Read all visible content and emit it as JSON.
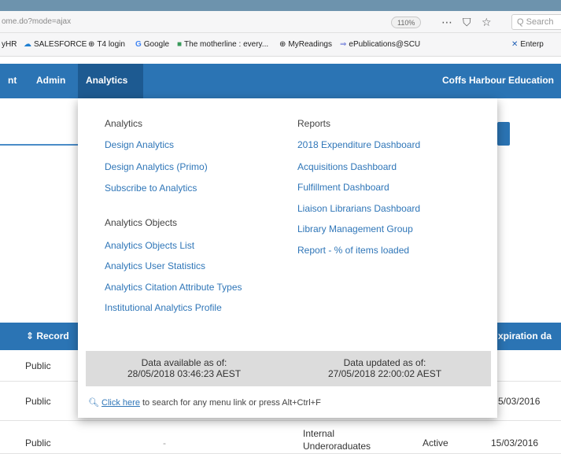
{
  "browser": {
    "url": "ome.do?mode=ajax",
    "zoom": "110%",
    "search_placeholder": "Q Search",
    "bookmarks": [
      {
        "label": "yHR",
        "icon": "text"
      },
      {
        "label": "SALESFORCE",
        "icon": "cloud-icon"
      },
      {
        "label": "T4 login",
        "icon": "globe-icon"
      },
      {
        "label": "Google",
        "icon": "google-icon"
      },
      {
        "label": "The motherline : every...",
        "icon": "bookmark-icon"
      },
      {
        "label": "MyReadings",
        "icon": "globe-icon"
      },
      {
        "label": "ePublications@SCU",
        "icon": "link-icon"
      },
      {
        "label": "Enterp",
        "icon": "x-icon"
      }
    ]
  },
  "nav": {
    "items": [
      "nt",
      "Admin",
      "Analytics"
    ],
    "institution": "Coffs Harbour Education"
  },
  "dropdown": {
    "analytics": {
      "heading": "Analytics",
      "links": [
        "Design Analytics",
        "Design Analytics (Primo)",
        "Subscribe to Analytics"
      ]
    },
    "objects": {
      "heading": "Analytics Objects",
      "links": [
        "Analytics Objects List",
        "Analytics User Statistics",
        "Analytics Citation Attribute Types",
        "Institutional Analytics Profile"
      ]
    },
    "reports": {
      "heading": "Reports",
      "links": [
        "2018 Expenditure Dashboard",
        "Acquisitions Dashboard",
        "Fulfillment Dashboard",
        "Liaison Librarians Dashboard",
        "Library Management Group",
        "Report - % of items loaded"
      ]
    },
    "data_available_label": "Data available as of:",
    "data_available_value": "28/05/2018 03:46:23 AEST",
    "data_updated_label": "Data updated as of:",
    "data_updated_value": "27/05/2018 22:00:02 AEST",
    "hint_link": "Click here",
    "hint_text": " to search for any menu link or press Alt+Ctrl+F"
  },
  "table": {
    "headers": {
      "record": "Record",
      "expiration": "xpiration da"
    },
    "rows": [
      {
        "record": "Public",
        "expiration": ""
      },
      {
        "record": "Public",
        "expiration": "5/03/2016"
      },
      {
        "record": "Public",
        "mid": "-",
        "group": "Internal Underoraduates",
        "status": "Active",
        "expiration": "15/03/2016"
      }
    ]
  },
  "colors": {
    "nav_bg": "#2b74b4",
    "nav_active": "#1d5a91",
    "link": "#2f76b8"
  }
}
